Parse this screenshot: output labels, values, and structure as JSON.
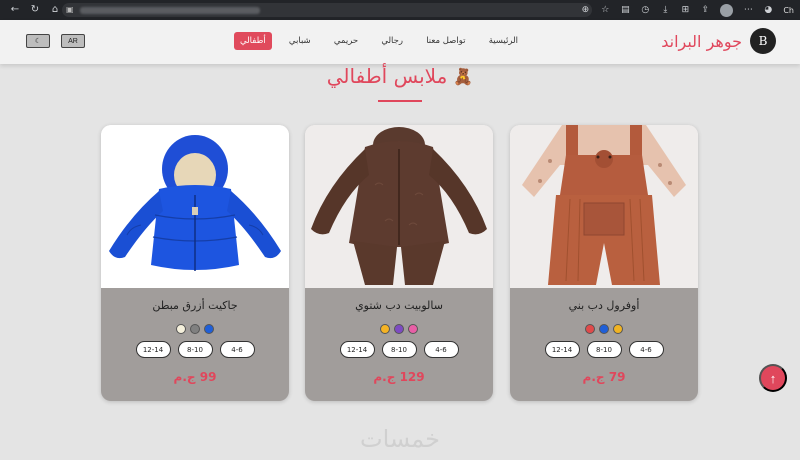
{
  "header": {
    "brand_name": "جوهر البراند",
    "brand_letter": "B",
    "nav": [
      {
        "label": "الرئيسية",
        "active": false
      },
      {
        "label": "تواصل معنا",
        "active": false
      },
      {
        "label": "رجالي",
        "active": false
      },
      {
        "label": "حريمي",
        "active": false
      },
      {
        "label": "شبابي",
        "active": false
      },
      {
        "label": "أطفالي",
        "active": true
      }
    ],
    "lang_button": "AR",
    "theme_icon": "moon-icon"
  },
  "section": {
    "title": "ملابس أطفالي",
    "emoji": "🧸"
  },
  "products": [
    {
      "name": "أوفرول دب بني",
      "colors": [
        "#e04a4a",
        "#1f5fd8",
        "#f0b323"
      ],
      "sizes": [
        "4-6",
        "8-10",
        "12-14"
      ],
      "price": "79 ج.م"
    },
    {
      "name": "سالوبيت دب شتوي",
      "colors": [
        "#f5b324",
        "#7d4bc2",
        "#e85fa6"
      ],
      "sizes": [
        "4-6",
        "8-10",
        "12-14"
      ],
      "price": "129 ج.م"
    },
    {
      "name": "جاكيت أزرق مبطن",
      "colors": [
        "#f5f0dc",
        "#808080",
        "#1f5fd8"
      ],
      "sizes": [
        "4-6",
        "8-10",
        "12-14"
      ],
      "price": "99 ج.م"
    }
  ],
  "watermark": "خمسات",
  "scroll_top_icon": "arrow-up-icon",
  "colors": {
    "accent": "#e0475c",
    "card_bg": "#a19d9b",
    "page_bg": "#e4e4e4"
  }
}
